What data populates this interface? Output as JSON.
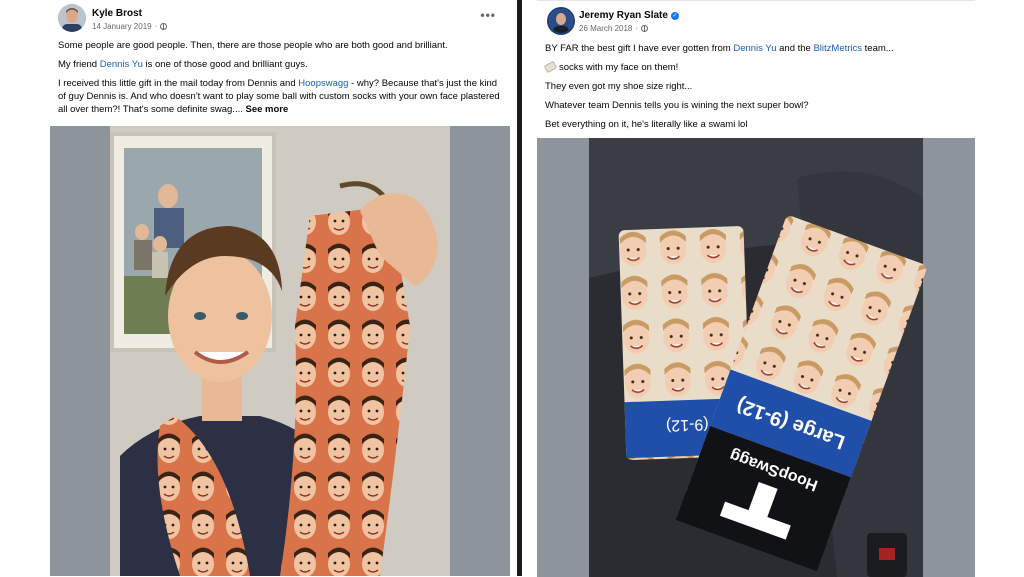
{
  "post1": {
    "author": "Kyle Brost",
    "date": "14 January 2019",
    "p1": "Some people are good people. Then, there are those people who are both good and brilliant.",
    "p2_before": "My friend ",
    "p2_link": "Dennis Yu",
    "p2_after": " is one of those good and brilliant guys.",
    "p3_before": "I received this little gift in the mail today from Dennis and ",
    "p3_link": "Hoopswagg",
    "p3_after": " - why? Because that's just the kind of guy Dennis is. And who doesn't want to play some ball with custom socks with your own face plastered all over them?! That's some definite swag.... ",
    "see_more": "See more"
  },
  "post2": {
    "author": "Jeremy Ryan Slate",
    "date": "26 March 2018",
    "p1_before": "BY FAR the best gift I have ever gotten from ",
    "p1_link1": "Dennis Yu",
    "p1_mid": " and the ",
    "p1_link2": "BlitzMetrics",
    "p1_after": " team...",
    "p2": "socks with my face on them!",
    "p3": "They even got my shoe size right...",
    "p4": "Whatever team Dennis tells you is wining the next super bowl?",
    "p5": "Bet everything on it, he's literally like a swami lol",
    "sock_size": "Large (9-12)",
    "sock_size_small": "(9-12)",
    "sock_brand": "HoopSwagg"
  },
  "colors": {
    "link": "#1a5fb4",
    "verified": "#1877f2",
    "sock_label": "#1f4fa8"
  }
}
